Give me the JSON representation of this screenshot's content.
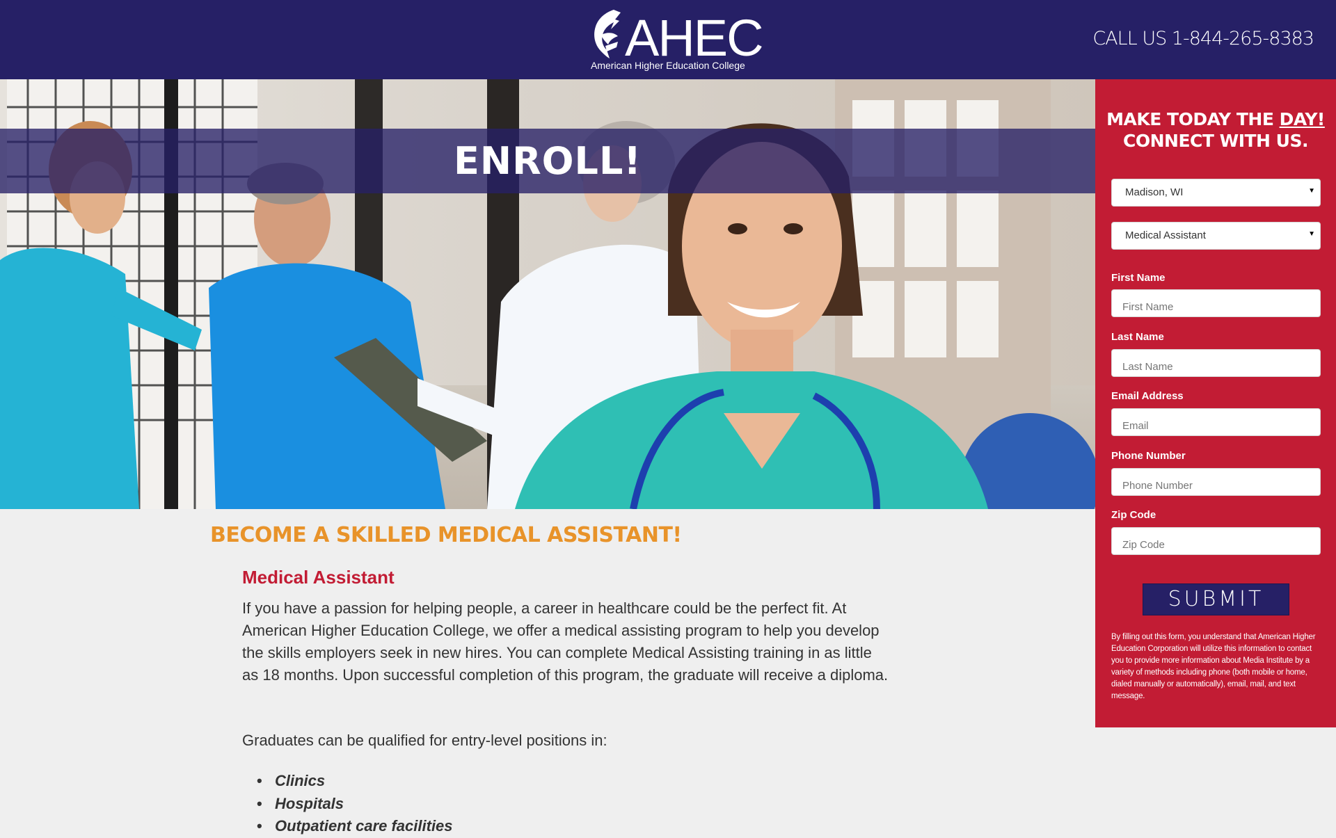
{
  "header": {
    "logo_text": "AHEC",
    "logo_subtitle": "American Higher Education College",
    "call_text": "CALL US 1-844-265-8383",
    "bg_color": "#262066"
  },
  "hero": {
    "banner_text": "ENROLL!"
  },
  "form": {
    "title_line1_pre": "MAKE TODAY THE ",
    "title_line1_underlined": "DAY!",
    "title_line2": "CONNECT WITH US.",
    "location_select": "Madison, WI",
    "program_select": "Medical Assistant",
    "fields": [
      {
        "label": "First Name",
        "placeholder": "First Name"
      },
      {
        "label": "Last Name",
        "placeholder": "Last Name"
      },
      {
        "label": "Email Address",
        "placeholder": "Email"
      },
      {
        "label": "Phone Number",
        "placeholder": "Phone Number"
      },
      {
        "label": "Zip Code",
        "placeholder": "Zip Code"
      }
    ],
    "submit_label": "SUBMIT",
    "disclaimer": "By filling out this form, you understand that American Higher Education Corporation will utilize this information to contact you to provide more information about Media Institute by a variety of methods including phone (both mobile or home, dialed manually or automatically), email, mail, and text message.",
    "bg_color": "#c21c34"
  },
  "content": {
    "headline": "BECOME A SKILLED MEDICAL ASSISTANT!",
    "subheading": "Medical Assistant",
    "paragraph": "If you have a passion for helping people, a career in healthcare could be the perfect fit. At American Higher Education College, we offer a medical assisting program to help you develop the skills employers seek in new hires. You can complete Medical Assisting training in as little as 18 months. Upon successful completion of this program, the graduate will receive a diploma.",
    "graduates_intro": "Graduates can be qualified for entry-level positions in:",
    "positions": [
      "Clinics",
      "Hospitals",
      "Outpatient care facilities"
    ]
  }
}
